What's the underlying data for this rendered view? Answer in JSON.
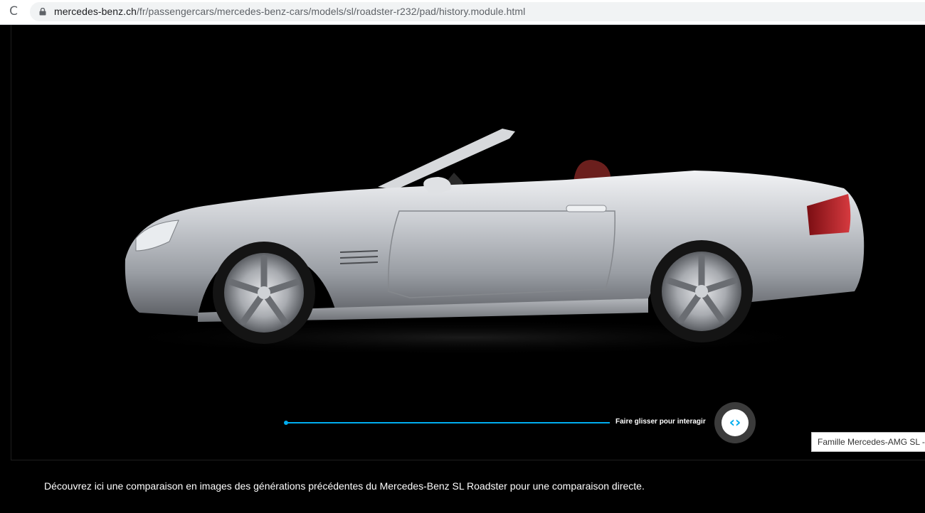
{
  "browser": {
    "reload_glyph": "C",
    "url_domain": "mercedes-benz.ch",
    "url_path": "/fr/passengercars/mercedes-benz-cars/models/sl/roadster-r232/pad/history.module.html",
    "lock_icon": "lock-icon"
  },
  "stage": {
    "image": "silver-convertible-side-view",
    "slider_hint": "Faire glisser pour interagir",
    "handle_glyph": "‹›",
    "accent_color": "#00adef"
  },
  "tooltip": {
    "text": "Famille Mercedes-AMG SL -"
  },
  "caption": "Découvrez ici une comparaison en images des générations précédentes du Mercedes-Benz SL Roadster pour une comparaison directe."
}
